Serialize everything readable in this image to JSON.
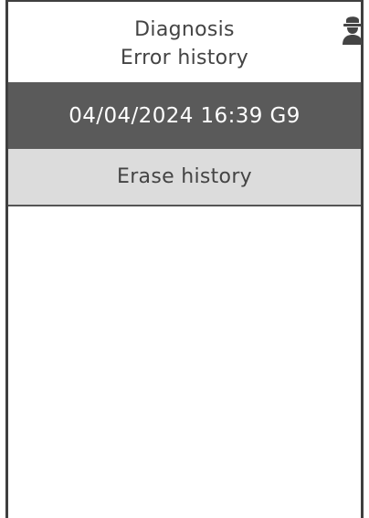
{
  "header": {
    "title_line1": "Diagnosis",
    "title_line2": "Error history",
    "user_icon": "user-icon"
  },
  "error_entries": [
    {
      "label": "04/04/2024 16:39 G9"
    }
  ],
  "actions": {
    "erase_label": "Erase history"
  },
  "colors": {
    "frame": "#3f3f3f",
    "selected_row_bg": "#5a5a5a",
    "action_row_bg": "#dcdcdc",
    "text": "#444444"
  }
}
